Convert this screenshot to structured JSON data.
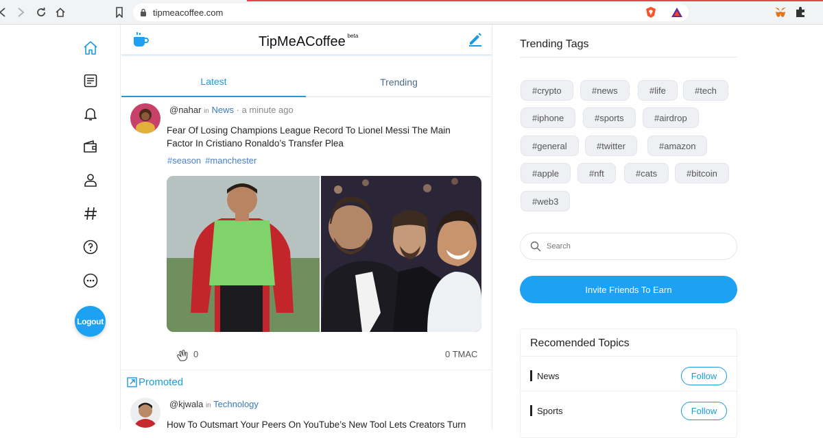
{
  "browser": {
    "url": "tipmeacoffee.com"
  },
  "brand": {
    "name": "TipMeACoffee",
    "badge": "beta"
  },
  "sidebar": {
    "items": [
      {
        "icon": "home-icon"
      },
      {
        "icon": "document-icon"
      },
      {
        "icon": "bell-icon"
      },
      {
        "icon": "wallet-icon"
      },
      {
        "icon": "user-icon"
      },
      {
        "icon": "hashtag-icon"
      },
      {
        "icon": "help-icon"
      },
      {
        "icon": "more-icon"
      }
    ],
    "logout_label": "Logout"
  },
  "tabs": [
    {
      "label": "Latest",
      "active": true
    },
    {
      "label": "Trending",
      "active": false
    }
  ],
  "posts": [
    {
      "user": "@nahar",
      "in": "in",
      "category": "News",
      "time": "· a minute ago",
      "title": "Fear Of Losing Champions League Record To Lionel Messi The Main Factor In Cristiano Ronaldo’s Transfer Plea",
      "tags": [
        "#season",
        "#manchester"
      ],
      "claps": "0",
      "tmac": "0 TMAC"
    },
    {
      "promoted_label": "Promoted",
      "user": "@kjwala",
      "in": "in",
      "category": "Technology",
      "title": "How To Outsmart Your Peers On YouTube’s New Tool Lets Creators Turn"
    }
  ],
  "trending": {
    "title": "Trending Tags",
    "tags": [
      "#crypto",
      "#news",
      "#life",
      "#tech",
      "#iphone",
      "#sports",
      "#airdrop",
      "#general",
      "#twitter",
      "#amazon",
      "#apple",
      "#nft",
      "#cats",
      "#bitcoin",
      "#web3"
    ]
  },
  "search": {
    "placeholder": "Search"
  },
  "invite_label": "Invite Friends To Earn",
  "topics": {
    "title": "Recomended Topics",
    "items": [
      {
        "name": "News",
        "action": "Follow"
      },
      {
        "name": "Sports",
        "action": "Follow"
      }
    ]
  },
  "colors": {
    "accent": "#1da1f2",
    "link": "#3b7ab8",
    "chip_bg": "#eef0f3"
  }
}
